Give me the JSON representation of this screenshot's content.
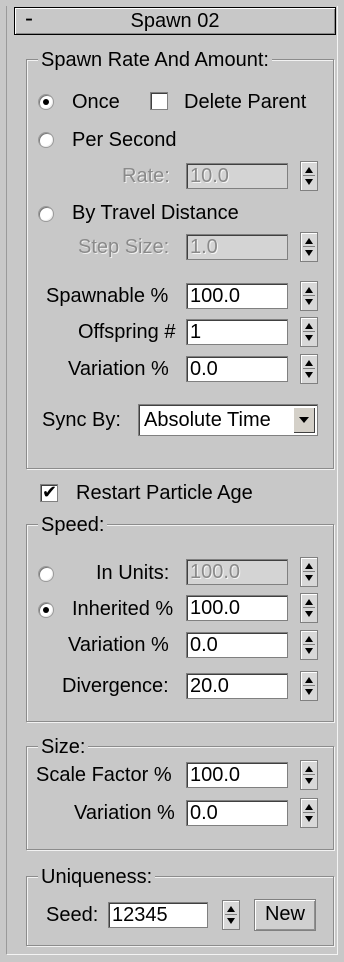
{
  "rollout": {
    "collapse_symbol": "-",
    "title": "Spawn 02"
  },
  "spawn_rate": {
    "legend": "Spawn Rate And Amount:",
    "once_label": "Once",
    "once_selected": true,
    "delete_parent_label": "Delete Parent",
    "delete_parent_checked": false,
    "per_second_label": "Per Second",
    "rate_label": "Rate:",
    "rate_value": "10.0",
    "by_travel_label": "By Travel Distance",
    "step_size_label": "Step Size:",
    "step_size_value": "1.0",
    "spawnable_label": "Spawnable %",
    "spawnable_value": "100.0",
    "offspring_label": "Offspring #",
    "offspring_value": "1",
    "variation_label": "Variation %",
    "variation_value": "0.0",
    "sync_by_label": "Sync By:",
    "sync_by_value": "Absolute Time"
  },
  "restart": {
    "label": "Restart Particle Age",
    "checked": true
  },
  "speed": {
    "legend": "Speed:",
    "in_units_label": "In Units:",
    "in_units_value": "100.0",
    "inherited_label": "Inherited %",
    "inherited_value": "100.0",
    "inherited_selected": true,
    "variation_label": "Variation %",
    "variation_value": "0.0",
    "divergence_label": "Divergence:",
    "divergence_value": "20.0"
  },
  "size": {
    "legend": "Size:",
    "scale_label": "Scale Factor %",
    "scale_value": "100.0",
    "variation_label": "Variation %",
    "variation_value": "0.0"
  },
  "uniqueness": {
    "legend": "Uniqueness:",
    "seed_label": "Seed:",
    "seed_value": "12345",
    "new_label": "New"
  },
  "icons": {
    "spinner": "spinner-arrows-icon",
    "dropdown": "dropdown-arrow-icon",
    "radio": "radio-icon",
    "checkbox": "checkbox-icon"
  }
}
